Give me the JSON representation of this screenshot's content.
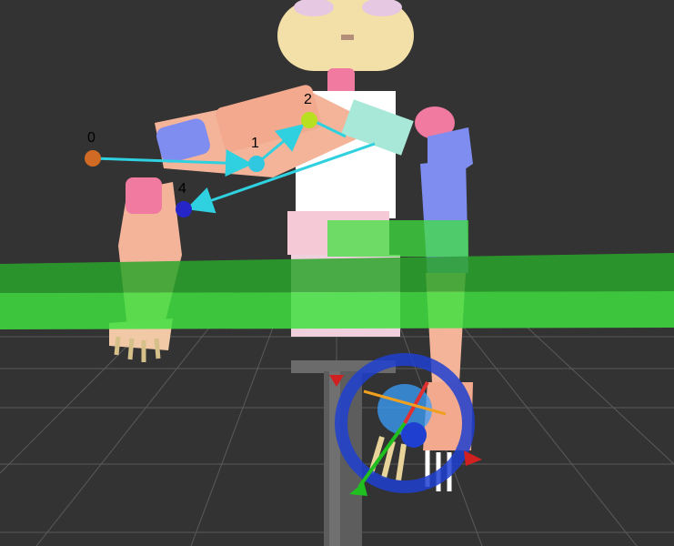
{
  "scene": {
    "waypoint_labels": [
      "0",
      "1",
      "2",
      "4"
    ],
    "colors": {
      "background": "#333333",
      "grid": "#5a5a5a",
      "table": "#3fe03f",
      "table_dark": "#2aa52a",
      "robot_skin": "#f4b49a",
      "robot_blue": "#7f8cf0",
      "robot_pink": "#f07aa0",
      "trajectory": "#2fd0e0",
      "marker_ring": "#1e3fd0"
    },
    "icons": [
      "waypoint-marker-icon",
      "interactive-marker-ring-icon",
      "axis-arrow-icon"
    ]
  }
}
